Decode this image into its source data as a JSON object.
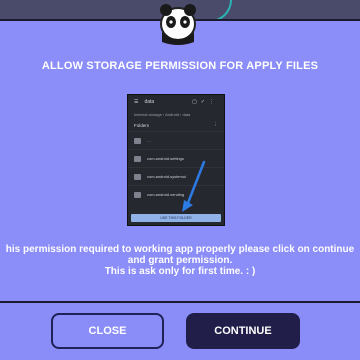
{
  "colors": {
    "background": "#8a8cf7",
    "dialog": "#8b8df8",
    "continue_button": "#211f4a",
    "close_border": "#1f2257"
  },
  "dialog": {
    "title": "ALLOW STORAGE PERMISSION FOR APPLY FILES",
    "message_lines": [
      "his permission required to working app properly please click on continue",
      "and grant permission.",
      "This is ask only for first time. : )"
    ],
    "logo_icon": "panda-logo-icon"
  },
  "preview": {
    "folder": "data",
    "breadcrumb": "Internal storage › Android › data",
    "section": "Folders",
    "section_extra": "⋮",
    "rows": [
      "…",
      "com.android.settings",
      "com.android.systemui",
      "com.android.vending"
    ],
    "use_button": "USE THIS FOLDER"
  },
  "buttons": {
    "close": "CLOSE",
    "continue": "CONTINUE"
  }
}
